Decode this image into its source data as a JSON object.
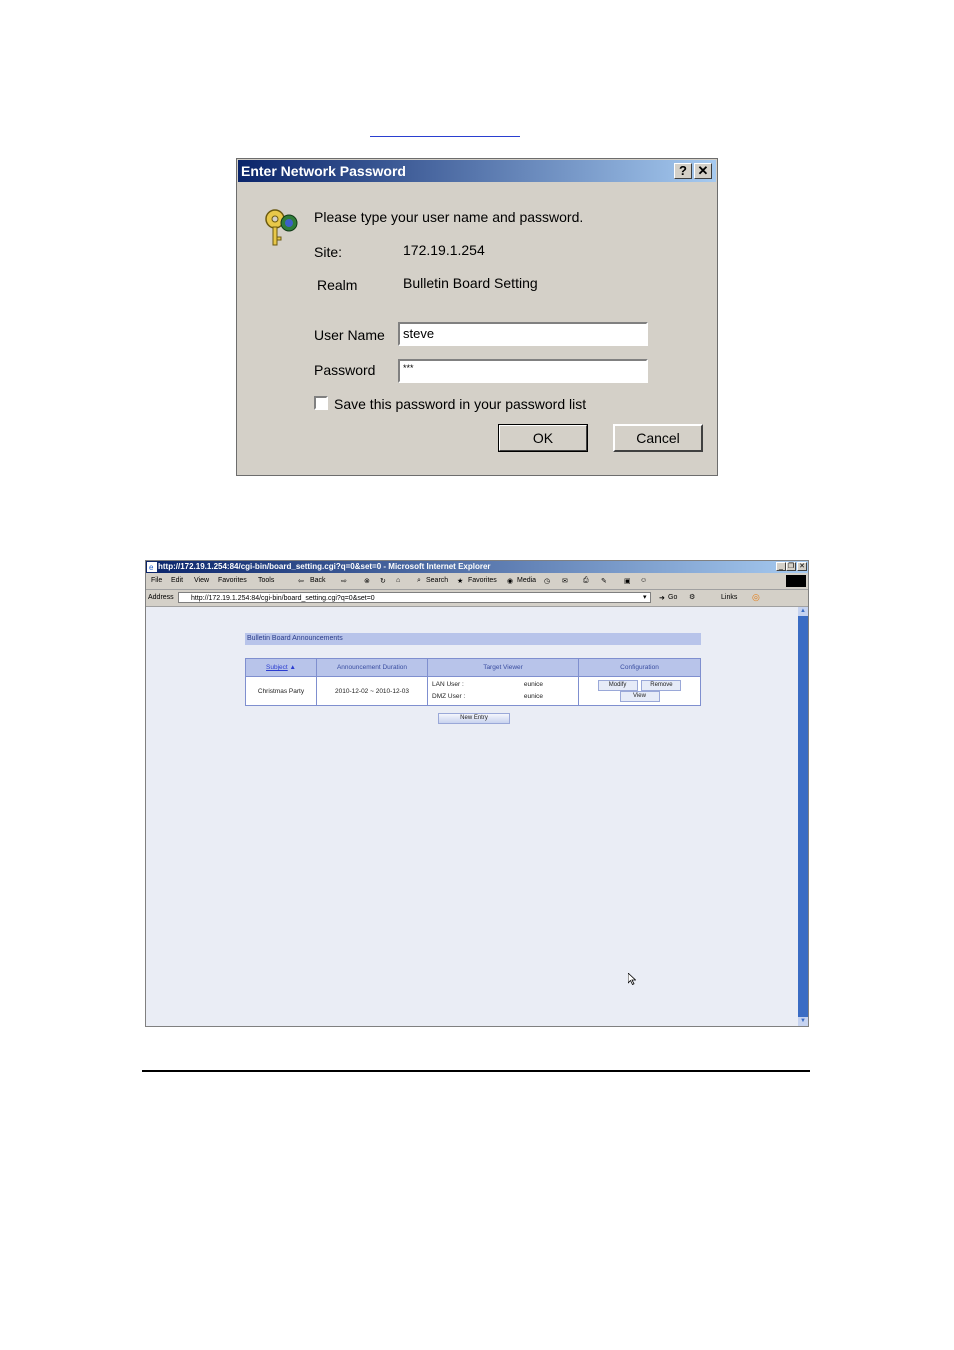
{
  "dialog": {
    "title": "Enter Network Password",
    "help_button": "?",
    "close_button": "✕",
    "prompt": "Please type your user name and password.",
    "site_label": "Site:",
    "site_value": "172.19.1.254",
    "realm_label": "Realm",
    "realm_value": "Bulletin Board Setting",
    "username_label": "User Name",
    "username_value": "steve",
    "password_label": "Password",
    "password_value": "***",
    "save_label": "Save this password in your password list",
    "ok_label": "OK",
    "cancel_label": "Cancel"
  },
  "browser": {
    "title": "http://172.19.1.254:84/cgi-bin/board_setting.cgi?q=0&set=0 - Microsoft Internet Explorer",
    "window_buttons": [
      "_",
      "❐",
      "✕"
    ],
    "menu": [
      "File",
      "Edit",
      "View",
      "Favorites",
      "Tools"
    ],
    "toolbar": {
      "back": "Back",
      "search": "Search",
      "favorites": "Favorites",
      "media": "Media"
    },
    "address_label": "Address",
    "address_value": "http://172.19.1.254:84/cgi-bin/board_setting.cgi?q=0&set=0",
    "go_label": "Go",
    "links_label": "Links",
    "page": {
      "header": "Bulletin Board Announcements",
      "columns": [
        "Subject",
        "Announcement Duration",
        "Target Viewer",
        "Configuration"
      ],
      "row": {
        "subject": "Christmas Party",
        "duration": "2010-12-02 ~ 2010-12-03",
        "lan_label": "LAN User :",
        "lan_value": "eunice",
        "dmz_label": "DMZ User :",
        "dmz_value": "eunice",
        "modify": "Modify",
        "remove": "Remove",
        "view": "View"
      },
      "new_entry": "New Entry"
    }
  }
}
